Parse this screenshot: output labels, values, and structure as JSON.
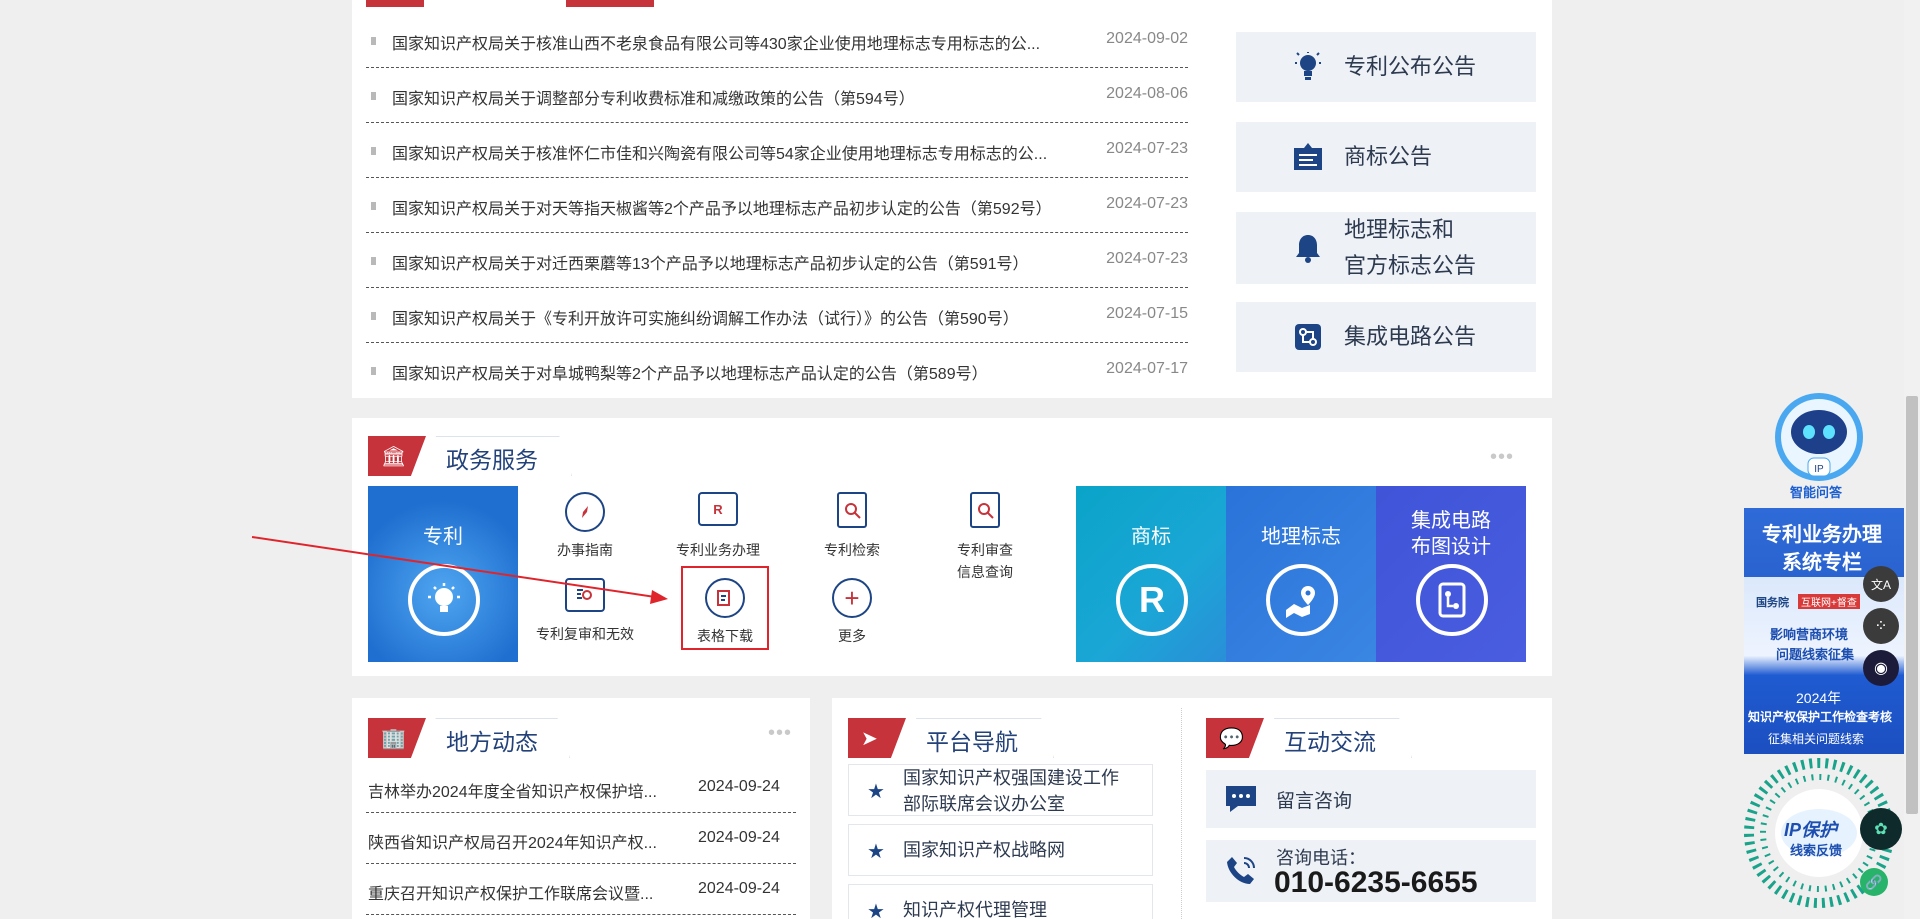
{
  "notices": [
    {
      "title": "国家知识产权局关于核准山西不老泉食品有限公司等430家企业使用地理标志专用标志的公...",
      "date": "2024-09-02"
    },
    {
      "title": "国家知识产权局关于调整部分专利收费标准和减缴政策的公告（第594号）",
      "date": "2024-08-06"
    },
    {
      "title": "国家知识产权局关于核准怀仁市佳和兴陶瓷有限公司等54家企业使用地理标志专用标志的公...",
      "date": "2024-07-23"
    },
    {
      "title": "国家知识产权局关于对天等指天椒酱等2个产品予以地理标志产品初步认定的公告（第592号）",
      "date": "2024-07-23"
    },
    {
      "title": "国家知识产权局关于对迁西栗蘑等13个产品予以地理标志产品初步认定的公告（第591号）",
      "date": "2024-07-23"
    },
    {
      "title": "国家知识产权局关于《专利开放许可实施纠纷调解工作办法（试行）》的公告（第590号）",
      "date": "2024-07-15"
    },
    {
      "title": "国家知识产权局关于对阜城鸭梨等2个产品予以地理标志产品认定的公告（第589号）",
      "date": "2024-07-17"
    }
  ],
  "announcements": {
    "patent": "专利公布公告",
    "trademark": "商标公告",
    "geo_line1": "地理标志和",
    "geo_line2": "官方标志公告",
    "ic": "集成电路公告"
  },
  "gov_service": {
    "title": "政务服务",
    "patent_tile": "专利",
    "items": {
      "guide": "办事指南",
      "business": "专利业务办理",
      "search": "专利检索",
      "exam_line1": "专利审查",
      "exam_line2": "信息查询",
      "review": "专利复审和无效",
      "forms": "表格下载",
      "more": "更多"
    },
    "tiles": {
      "trademark": "商标",
      "geo": "地理标志",
      "ic_line1": "集成电路",
      "ic_line2": "布图设计"
    },
    "icon_glyphs": {
      "trademark": "R",
      "patent_business": "R"
    }
  },
  "local": {
    "title": "地方动态",
    "items": [
      {
        "title": "吉林举办2024年度全省知识产权保护培...",
        "date": "2024-09-24"
      },
      {
        "title": "陕西省知识产权局召开2024年知识产权...",
        "date": "2024-09-24"
      },
      {
        "title": "重庆召开知识产权保护工作联席会议暨...",
        "date": "2024-09-24"
      }
    ]
  },
  "platform_nav": {
    "title": "平台导航",
    "items": [
      {
        "line1": "国家知识产权强国建设工作",
        "line2": "部际联席会议办公室"
      },
      {
        "line1": "国家知识产权战略网",
        "line2": ""
      },
      {
        "line1": "知识产权代理管理",
        "line2": ""
      }
    ]
  },
  "interaction": {
    "title": "互动交流",
    "consult": "留言咨询",
    "phone_label": "咨询电话：",
    "phone": "010-6235-6655"
  },
  "sidebar": {
    "robot_label": "智能问答",
    "banner_line1": "专利业务办理",
    "banner_line2": "系统专栏",
    "banner_small1": "国务院",
    "banner_small2": "互联网+督查",
    "banner_small3": "影响营商环境",
    "banner_small4": "问题线索征集",
    "banner_year": "2024年",
    "banner_b1": "知识产权保护工作检查考核",
    "banner_b2": "征集相关问题线索",
    "qr_text1": "IP保护",
    "qr_text2": "线索反馈"
  },
  "colors": {
    "accent_red": "#c7333b",
    "navy": "#23427a",
    "teal": "#0aa4c8",
    "blue": "#2a73d9",
    "indigo": "#3f54d8"
  }
}
